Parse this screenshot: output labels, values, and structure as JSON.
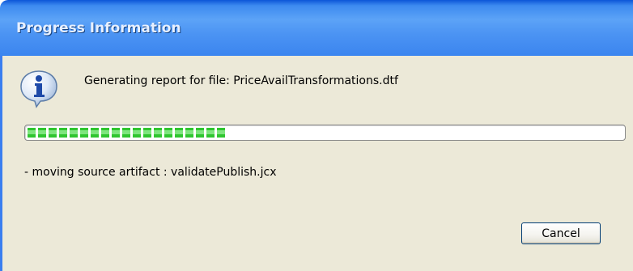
{
  "window": {
    "title": "Progress Information"
  },
  "icon": {
    "name": "info-icon",
    "glyph": "i"
  },
  "message": "Generating report for file: PriceAvailTransformations.dtf",
  "progress": {
    "fraction": 0.34
  },
  "subtask": "- moving source artifact : validatePublish.jcx",
  "buttons": {
    "cancel": "Cancel"
  }
}
